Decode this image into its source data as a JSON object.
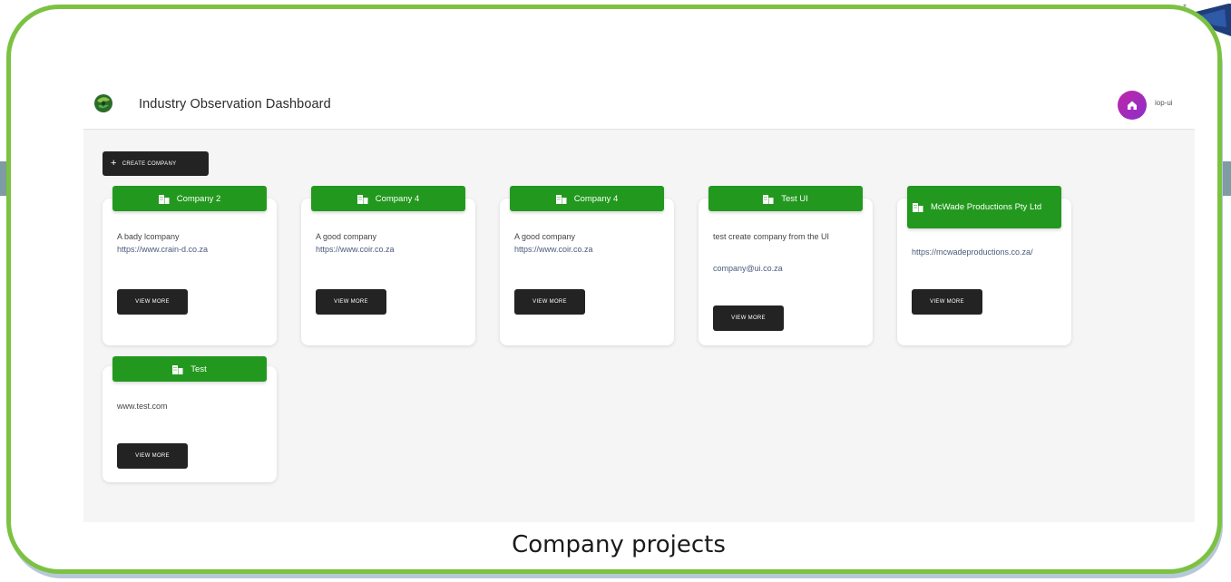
{
  "app": {
    "title": "Industry Observation Dashboard",
    "username": "iop-ui",
    "accent_color": "#22991e",
    "frame_color": "#7cc242"
  },
  "toolbar": {
    "create_label": "CREATE COMPANY",
    "create_icon": "plus-icon"
  },
  "companies": [
    {
      "name": "Company 2",
      "description": "A bady lcompany",
      "link": "https://www.crain-d.co.za",
      "button": "VIEW MORE",
      "icon": "building-icon"
    },
    {
      "name": "Company 4",
      "description": "A good company",
      "link": "https://www.coir.co.za",
      "button": "VIEW MORE",
      "icon": "building-icon"
    },
    {
      "name": "Company 4",
      "description": "A good company",
      "link": "https://www.coir.co.za",
      "button": "VIEW MORE",
      "icon": "building-icon"
    },
    {
      "name": "Test UI",
      "description": "test create company from the UI",
      "link": "company@ui.co.za",
      "button": "VIEW MORE",
      "icon": "building-icon"
    },
    {
      "name": "McWade Productions Pty Ltd",
      "description": "",
      "link": "https://mcwadeproductions.co.za/",
      "button": "VIEW MORE",
      "icon": "building-icon"
    },
    {
      "name": "Test",
      "description": "",
      "link": "www.test.com",
      "button": "VIEW MORE",
      "icon": "building-icon"
    }
  ],
  "caption": "Company projects"
}
